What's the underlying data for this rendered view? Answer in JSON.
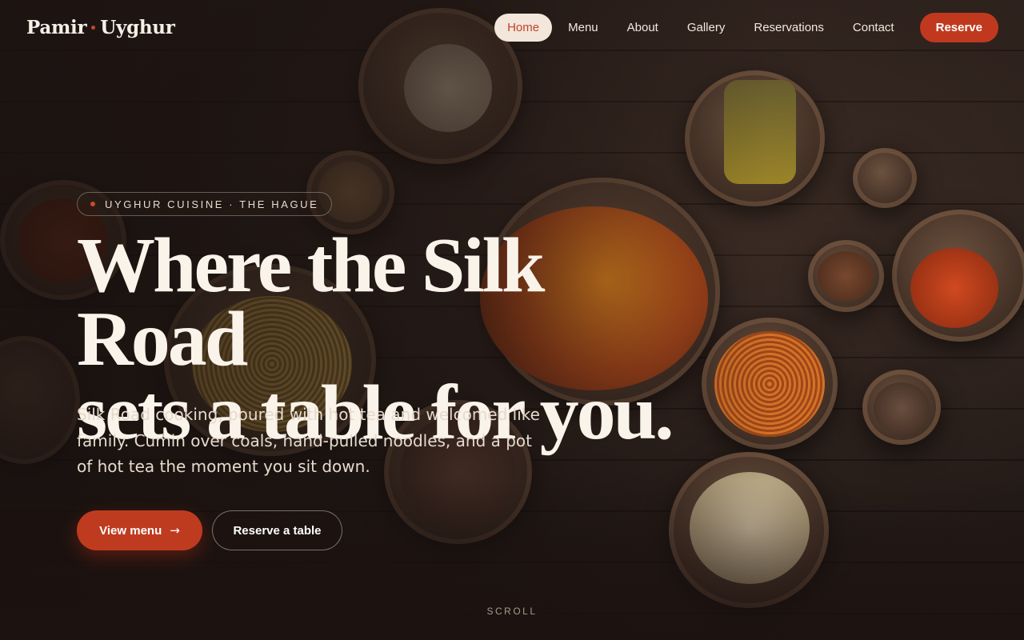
{
  "brand": {
    "name_part1": "Pamir",
    "name_part2": "Uyghur"
  },
  "nav": {
    "links": [
      {
        "label": "Home",
        "active": true
      },
      {
        "label": "Menu"
      },
      {
        "label": "About"
      },
      {
        "label": "Gallery"
      },
      {
        "label": "Reservations"
      },
      {
        "label": "Contact"
      }
    ],
    "cta_label": "Reserve"
  },
  "hero": {
    "badge": "UYGHUR CUISINE · THE HAGUE",
    "headline_line1": "Where the Silk Road",
    "headline_line2": "sets a table for you.",
    "subcopy": "Silk Road cooking, poured with hot tea and welcomed like family. Cumin over coals, hand-pulled noodles, and a pot of hot tea the moment you sit down.",
    "primary_button": "View menu",
    "primary_icon": "arrow-right-icon",
    "secondary_button": "Reserve a table",
    "scroll_label": "SCROLL"
  },
  "colors": {
    "accent": "#c0391f",
    "background": "#1d1412",
    "text": "#f4ece4"
  }
}
